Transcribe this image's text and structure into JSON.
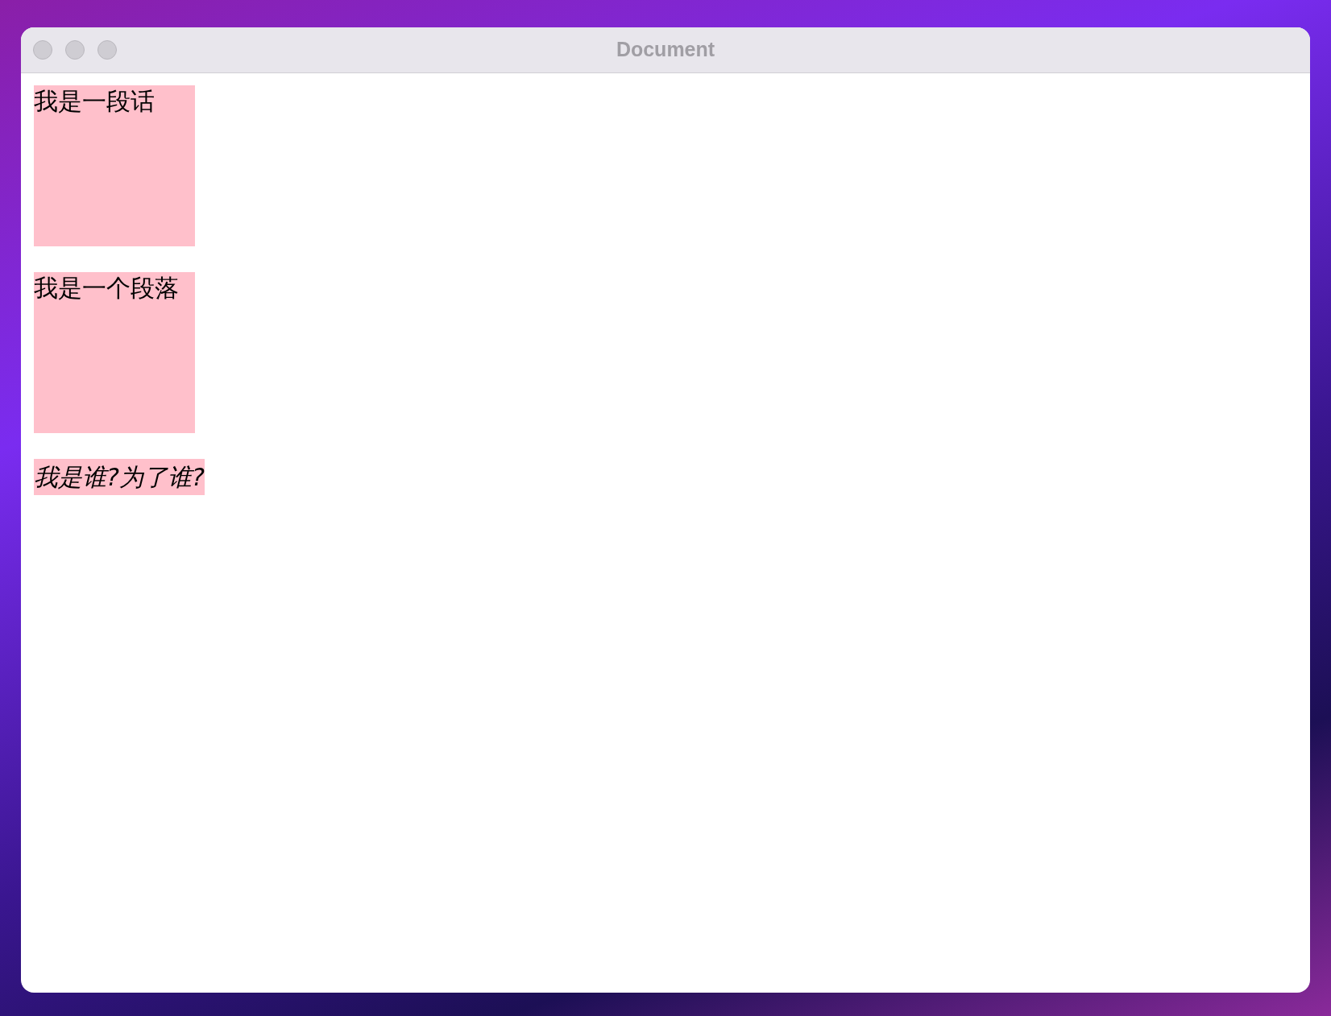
{
  "window": {
    "title": "Document"
  },
  "blocks": [
    {
      "kind": "box",
      "text": "我是一段话"
    },
    {
      "kind": "box",
      "text": "我是一个段落"
    },
    {
      "kind": "inline-italic",
      "text": "我是谁?为了谁?"
    }
  ]
}
